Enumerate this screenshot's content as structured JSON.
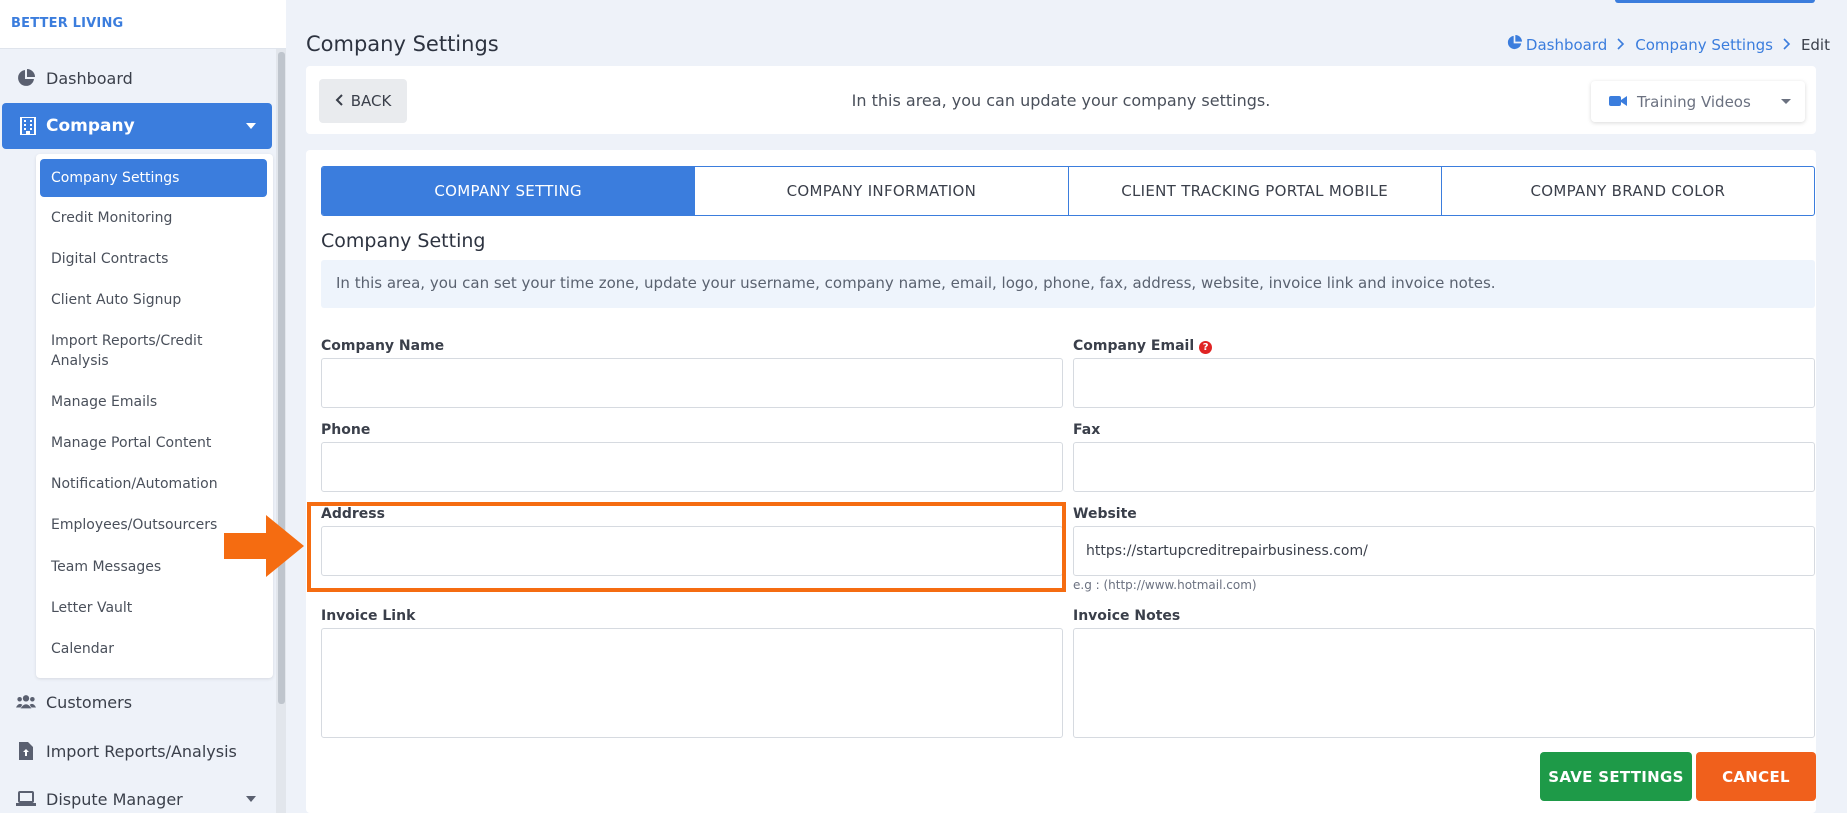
{
  "brand": "BETTER LIVING",
  "sidebar": {
    "dashboard": "Dashboard",
    "company": "Company",
    "submenu": [
      "Company Settings",
      "Credit Monitoring",
      "Digital Contracts",
      "Client Auto Signup",
      "Import Reports/Credit Analysis",
      "Manage Emails",
      "Manage Portal Content",
      "Notification/Automation",
      "Employees/Outsourcers",
      "Team Messages",
      "Letter Vault",
      "Calendar"
    ],
    "customers": "Customers",
    "import_reports": "Import Reports/Analysis",
    "dispute_manager": "Dispute Manager"
  },
  "header": {
    "title": "Company Settings",
    "breadcrumb": {
      "dashboard": "Dashboard",
      "company_settings": "Company Settings",
      "current": "Edit"
    }
  },
  "topbar": {
    "back": "BACK",
    "text": "In this area, you can update your company settings.",
    "training": "Training Videos"
  },
  "tabs": [
    "COMPANY SETTING",
    "COMPANY INFORMATION",
    "CLIENT TRACKING PORTAL MOBILE",
    "COMPANY BRAND COLOR"
  ],
  "section": {
    "title": "Company Setting",
    "info": "In this area, you can set your time zone, update your username, company name, email, logo, phone, fax, address, website, invoice link and invoice notes."
  },
  "form": {
    "company_name": {
      "label": "Company Name",
      "value": ""
    },
    "company_email": {
      "label": "Company Email",
      "value": ""
    },
    "phone": {
      "label": "Phone",
      "value": ""
    },
    "fax": {
      "label": "Fax",
      "value": ""
    },
    "address": {
      "label": "Address",
      "value": ""
    },
    "website": {
      "label": "Website",
      "value": "https://startupcreditrepairbusiness.com/",
      "hint": "e.g : (http://www.hotmail.com)"
    },
    "invoice_link": {
      "label": "Invoice Link",
      "value": ""
    },
    "invoice_notes": {
      "label": "Invoice Notes",
      "value": ""
    }
  },
  "actions": {
    "save": "SAVE SETTINGS",
    "cancel": "CANCEL"
  },
  "colors": {
    "accent": "#3b7ddd",
    "save": "#1e9a48",
    "cancel": "#f0601c",
    "highlight": "#f56c11"
  }
}
